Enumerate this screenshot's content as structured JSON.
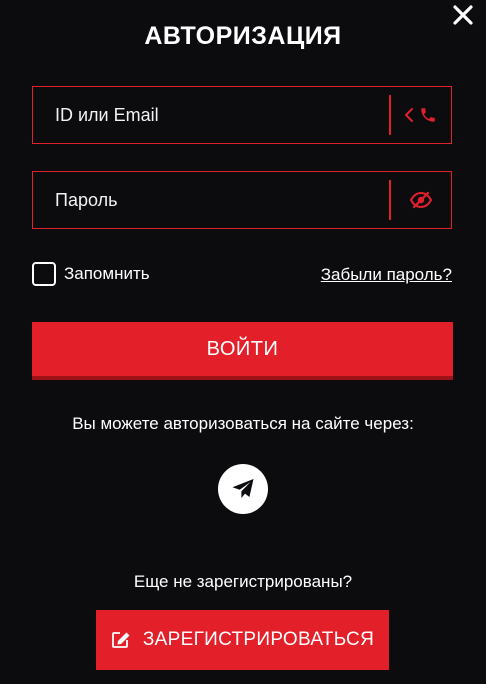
{
  "header": {
    "title": "АВТОРИЗАЦИЯ",
    "close_icon": "close-icon"
  },
  "form": {
    "login": {
      "placeholder": "ID или Email",
      "value": "",
      "addon_icons": [
        "chevron-left-icon",
        "phone-icon"
      ]
    },
    "password": {
      "placeholder": "Пароль",
      "value": "",
      "addon_icon": "eye-hidden-icon"
    },
    "remember_label": "Запомнить",
    "remember_checked": false,
    "forgot_label": "Забыли пароль?",
    "submit_label": "ВОЙТИ"
  },
  "social": {
    "text": "Вы можете авторизоваться на сайте через:",
    "providers": [
      "telegram-icon"
    ]
  },
  "register": {
    "prompt": "Еще не зарегистрированы?",
    "button_label": "ЗАРЕГИСТРИРОВАТЬСЯ",
    "button_icon": "edit-icon"
  },
  "colors": {
    "background": "#0c0c0f",
    "accent": "#e3202a",
    "text": "#ffffff"
  }
}
